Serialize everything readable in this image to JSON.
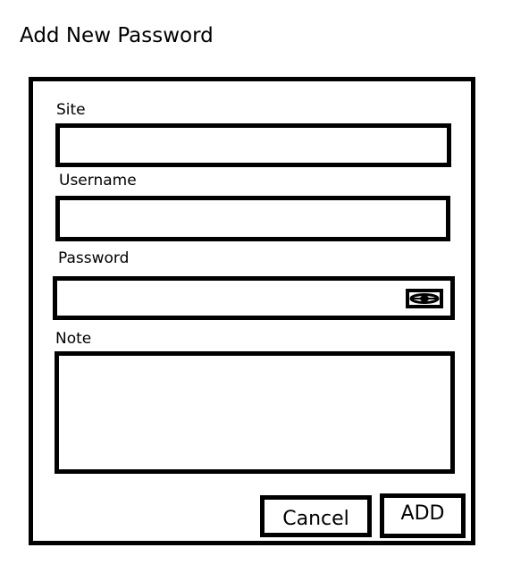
{
  "page": {
    "title": "Add New Password"
  },
  "form": {
    "site": {
      "label": "Site",
      "value": "",
      "placeholder": ""
    },
    "username": {
      "label": "Username",
      "value": "",
      "placeholder": ""
    },
    "password": {
      "label": "Password",
      "value": "",
      "placeholder": "",
      "reveal_icon": "eye-icon"
    },
    "note": {
      "label": "Note",
      "value": "",
      "placeholder": ""
    }
  },
  "actions": {
    "cancel_label": "Cancel",
    "add_label": "ADD"
  },
  "colors": {
    "border": "#000000",
    "background": "#ffffff"
  }
}
